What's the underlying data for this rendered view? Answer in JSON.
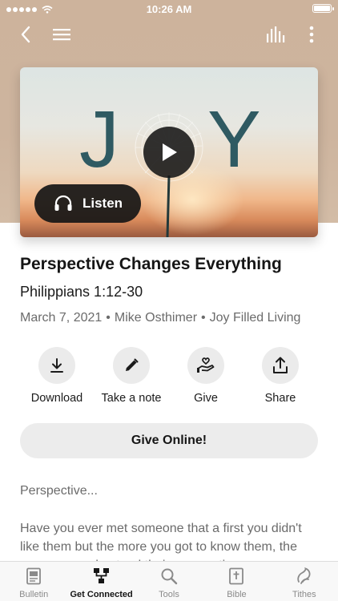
{
  "status_bar": {
    "time": "10:26 AM",
    "battery_level": 1.0
  },
  "header": {
    "back_icon": "chevron-left-icon",
    "menu_icon": "hamburger-menu-icon",
    "audio_icon": "audio-bars-icon",
    "more_icon": "more-vertical-icon"
  },
  "artwork": {
    "letters": [
      "J",
      "Y"
    ],
    "play_icon": "play-icon",
    "listen_label": "Listen",
    "listen_icon": "headphones-icon"
  },
  "sermon": {
    "title": "Perspective Changes Everything",
    "scripture": "Philippians 1:12-30",
    "date": "March 7, 2021",
    "separator": "•",
    "speaker": "Mike Osthimer",
    "series": "Joy Filled Living"
  },
  "actions": [
    {
      "label": "Download",
      "icon": "download-icon"
    },
    {
      "label": "Take a note",
      "icon": "pencil-icon"
    },
    {
      "label": "Give",
      "icon": "hand-heart-icon"
    },
    {
      "label": "Share",
      "icon": "share-icon"
    }
  ],
  "give_online_label": "Give Online!",
  "description": {
    "heading": "Perspective...",
    "body": "Have you ever met someone that a first you didn't like them but the more you got to know them, the more you understood their perspective..."
  },
  "tabbar": {
    "active": "Get Connected",
    "tabs": [
      {
        "label": "Bulletin",
        "icon": "bulletin-icon"
      },
      {
        "label": "Get Connected",
        "icon": "connected-icon"
      },
      {
        "label": "Tools",
        "icon": "search-icon"
      },
      {
        "label": "Bible",
        "icon": "bible-icon"
      },
      {
        "label": "Tithes",
        "icon": "tithes-icon"
      }
    ]
  },
  "colors": {
    "hero_bg": "#cdb39c",
    "art_text": "#2f5a62",
    "pill_bg": "#ececec",
    "muted_text": "#6b6b6b"
  }
}
